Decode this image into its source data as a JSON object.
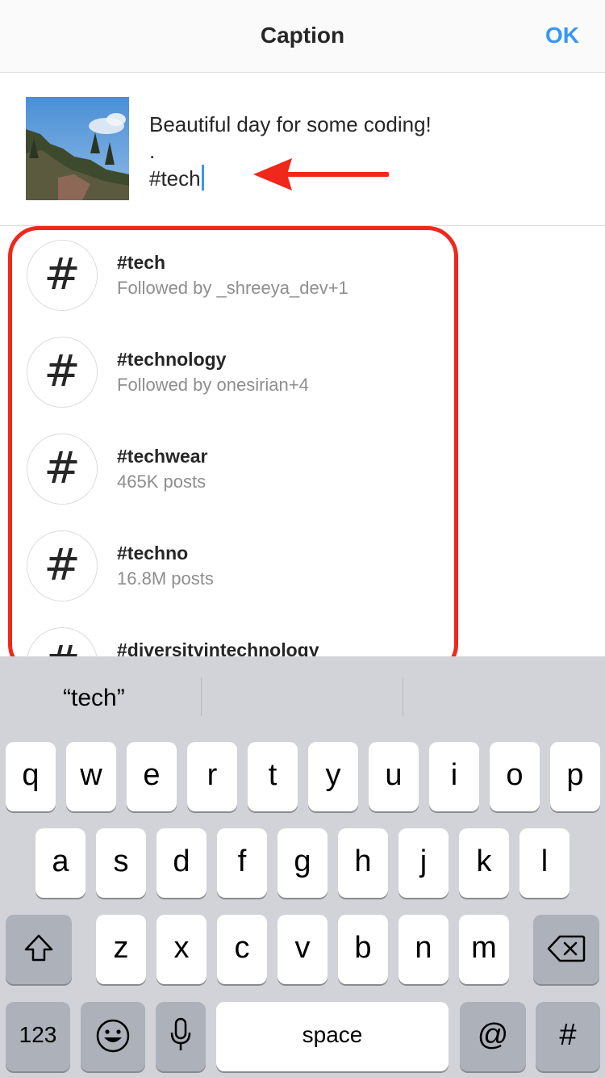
{
  "header": {
    "title": "Caption",
    "ok_label": "OK"
  },
  "compose": {
    "line1": "Beautiful day for some coding!",
    "line2": ".",
    "line3": "#tech"
  },
  "suggestions": [
    {
      "name": "#tech",
      "sub": "Followed by _shreeya_dev+1",
      "icon": "hashtag-icon"
    },
    {
      "name": "#technology",
      "sub": "Followed by onesirian+4",
      "icon": "hashtag-icon"
    },
    {
      "name": "#techwear",
      "sub": "465K posts",
      "icon": "hashtag-icon"
    },
    {
      "name": "#techno",
      "sub": "16.8M posts",
      "icon": "hashtag-icon"
    },
    {
      "name": "#diversityintechnology",
      "sub": "",
      "icon": "hashtag-icon"
    }
  ],
  "keyboard": {
    "prediction": "“tech”",
    "row1": [
      "q",
      "w",
      "e",
      "r",
      "t",
      "y",
      "u",
      "i",
      "o",
      "p"
    ],
    "row2": [
      "a",
      "s",
      "d",
      "f",
      "g",
      "h",
      "j",
      "k",
      "l"
    ],
    "row3": [
      "z",
      "x",
      "c",
      "v",
      "b",
      "n",
      "m"
    ],
    "numbers_label": "123",
    "space_label": "space",
    "at_label": "@",
    "hash_label": "#"
  },
  "colors": {
    "accent": "#3897f0",
    "annotation": "#f0271b"
  }
}
